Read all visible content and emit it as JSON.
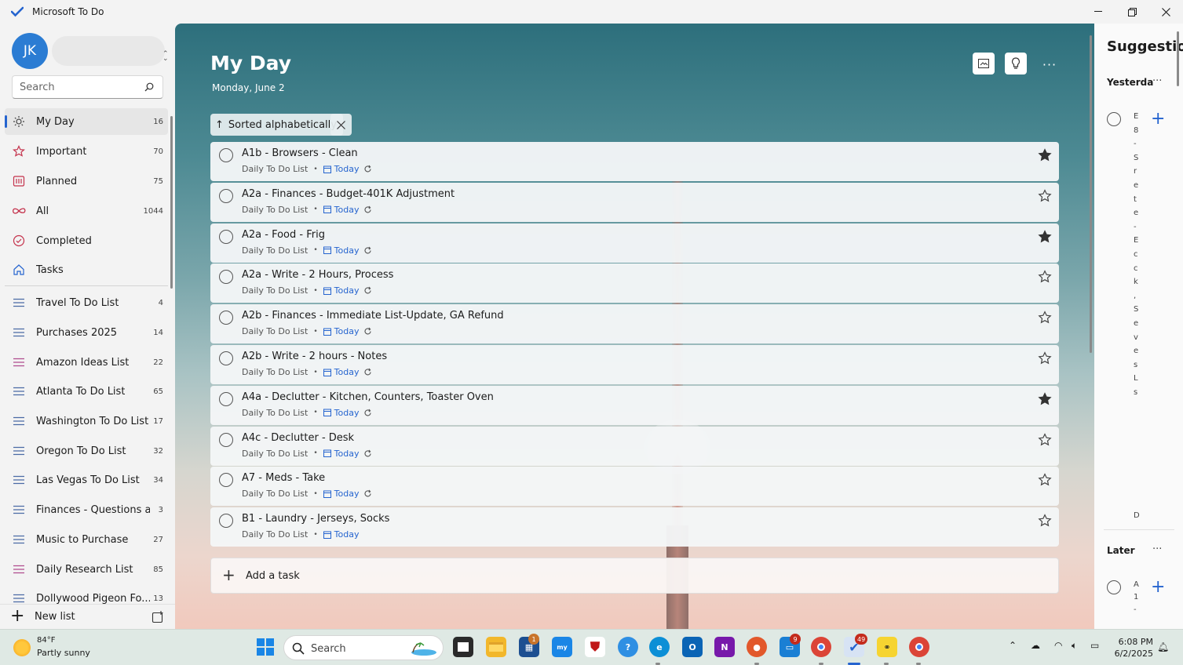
{
  "window": {
    "title": "Microsoft To Do"
  },
  "account": {
    "initials": "JK"
  },
  "search": {
    "placeholder": "Search"
  },
  "nav": [
    {
      "label": "My Day",
      "count": "16",
      "icon": "sun-icon",
      "active": true
    },
    {
      "label": "Important",
      "count": "70",
      "icon": "star-icon"
    },
    {
      "label": "Planned",
      "count": "75",
      "icon": "calendar-icon"
    },
    {
      "label": "All",
      "count": "1044",
      "icon": "infinity-icon"
    },
    {
      "label": "Completed",
      "count": "",
      "icon": "check-circle-icon"
    },
    {
      "label": "Tasks",
      "count": "",
      "icon": "home-icon"
    }
  ],
  "lists": [
    {
      "label": "Travel To Do List",
      "count": "4"
    },
    {
      "label": "Purchases 2025",
      "count": "14"
    },
    {
      "label": "Amazon Ideas List",
      "count": "22"
    },
    {
      "label": "Atlanta To Do List",
      "count": "65"
    },
    {
      "label": "Washington To Do List",
      "count": "17"
    },
    {
      "label": "Oregon To Do List",
      "count": "32"
    },
    {
      "label": "Las Vegas To Do List",
      "count": "34"
    },
    {
      "label": "Finances - Questions a...",
      "count": "3"
    },
    {
      "label": "Music to Purchase",
      "count": "27"
    },
    {
      "label": "Daily Research List",
      "count": "85"
    },
    {
      "label": "Dollywood Pigeon Fo...",
      "count": "13"
    }
  ],
  "new_list": {
    "label": "New list"
  },
  "main": {
    "title": "My Day",
    "date": "Monday, June 2",
    "sort_label": "Sorted alphabetically"
  },
  "tasks": [
    {
      "title": "A1b - Browsers - Clean",
      "list": "Daily To Do List",
      "due": "Today",
      "repeat": true,
      "important": true
    },
    {
      "title": "A2a - Finances - Budget-401K Adjustment",
      "list": "Daily To Do List",
      "due": "Today",
      "repeat": true,
      "important": false
    },
    {
      "title": "A2a - Food - Frig",
      "list": "Daily To Do List",
      "due": "Today",
      "repeat": true,
      "important": true
    },
    {
      "title": "A2a - Write - 2 Hours, Process",
      "list": "Daily To Do List",
      "due": "Today",
      "repeat": true,
      "important": false
    },
    {
      "title": "A2b - Finances - Immediate List-Update, GA Refund",
      "list": "Daily To Do List",
      "due": "Today",
      "repeat": true,
      "important": false
    },
    {
      "title": "A2b - Write - 2 hours - Notes",
      "list": "Daily To Do List",
      "due": "Today",
      "repeat": true,
      "important": false
    },
    {
      "title": "A4a - Declutter - Kitchen, Counters, Toaster Oven",
      "list": "Daily To Do List",
      "due": "Today",
      "repeat": true,
      "important": true
    },
    {
      "title": "A4c - Declutter - Desk",
      "list": "Daily To Do List",
      "due": "Today",
      "repeat": true,
      "important": false
    },
    {
      "title": "A7 - Meds - Take",
      "list": "Daily To Do List",
      "due": "Today",
      "repeat": true,
      "important": false
    },
    {
      "title": "B1 - Laundry - Jerseys, Socks",
      "list": "Daily To Do List",
      "due": "Today",
      "repeat": false,
      "important": false
    }
  ],
  "add_task": {
    "label": "Add a task"
  },
  "suggestions": {
    "title": "Suggestio",
    "yesterday": "Yesterda",
    "later": "Later",
    "letters": [
      "E",
      "8",
      "-",
      "S",
      "r",
      "e",
      "t",
      "e",
      "-",
      "E",
      "c",
      "c",
      "k",
      ",",
      "S",
      "e",
      "v",
      "e",
      "s",
      "L",
      "s"
    ],
    "footer_letter": "D",
    "later_letters": [
      "A",
      "1",
      "-"
    ]
  },
  "taskbar": {
    "temp": "84°F",
    "condition": "Partly sunny",
    "search_label": "Search",
    "badges": {
      "store": "1",
      "app9": "9",
      "todo": "49"
    },
    "time": "6:08 PM",
    "date": "6/2/2025"
  }
}
